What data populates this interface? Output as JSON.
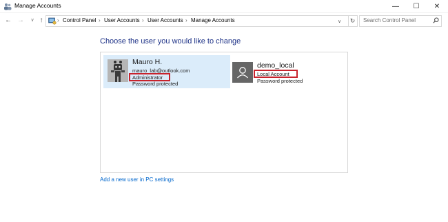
{
  "window": {
    "title": "Manage Accounts",
    "minimize_glyph": "—",
    "maximize_glyph": "☐",
    "close_glyph": "✕"
  },
  "nav": {
    "back_glyph": "←",
    "forward_glyph": "→",
    "recent_glyph": "∨",
    "up_glyph": "↑",
    "refresh_glyph": "↻",
    "dropdown_glyph": "∨",
    "separator_glyph": "›"
  },
  "breadcrumb": {
    "items": [
      "Control Panel",
      "User Accounts",
      "User Accounts",
      "Manage Accounts"
    ]
  },
  "search": {
    "placeholder": "Search Control Panel",
    "icon": "search-icon"
  },
  "main": {
    "heading": "Choose the user you would like to change",
    "accounts": [
      {
        "name": "Mauro H.",
        "email": "mauro_lab@outlook.com",
        "type": "Administrator",
        "status": "Password protected",
        "selected": true,
        "avatar": "robot-avatar"
      },
      {
        "name": "demo_local",
        "type": "Local Account",
        "status": "Password protected",
        "selected": false,
        "avatar": "default-user-icon"
      }
    ],
    "add_user_link": "Add a new user in PC settings"
  },
  "colors": {
    "heading": "#1e3287",
    "link": "#0066cc",
    "selected_bg": "#dbecfa",
    "highlight_box": "#c8232c",
    "default_avatar_bg": "#666666"
  }
}
